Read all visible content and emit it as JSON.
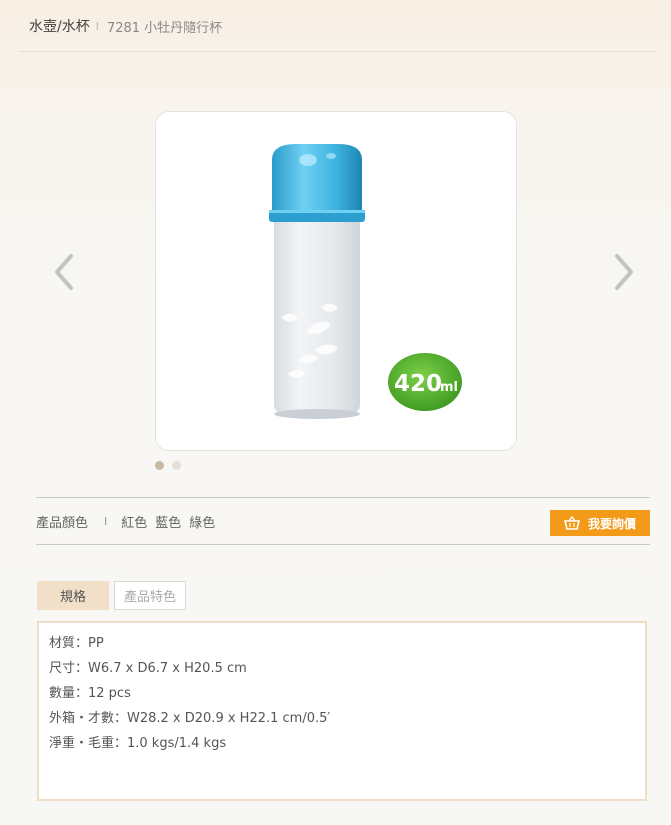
{
  "breadcrumb": {
    "category": "水壺/水杯",
    "separator": "I",
    "current": "7281 小牡丹隨行杯"
  },
  "gallery": {
    "prev_icon": "chevron-left-icon",
    "next_icon": "chevron-right-icon",
    "badge_number": "420",
    "badge_unit": "ml",
    "slides": 2,
    "active_slide": 1
  },
  "colors": {
    "label": "產品顏色",
    "separator": "I",
    "options": [
      "紅色",
      "藍色",
      "綠色"
    ]
  },
  "inquiry": {
    "label": "我要詢價",
    "icon": "basket-icon"
  },
  "tabs": [
    "規格",
    "產品特色"
  ],
  "specs": [
    "材質：PP",
    "尺寸：W6.7 x D6.7 x H20.5 cm",
    "數量：12 pcs",
    "外箱・才數：W28.2 x D20.9 x H22.1 cm/0.5′",
    "淨重・毛重：1.0 kgs/1.4 kgs"
  ],
  "theme": {
    "accent": "#f39a19",
    "tab_active": "#f1dfc8",
    "bottle_cap": "#3fb4e0",
    "badge_green": "#4caf2a"
  }
}
